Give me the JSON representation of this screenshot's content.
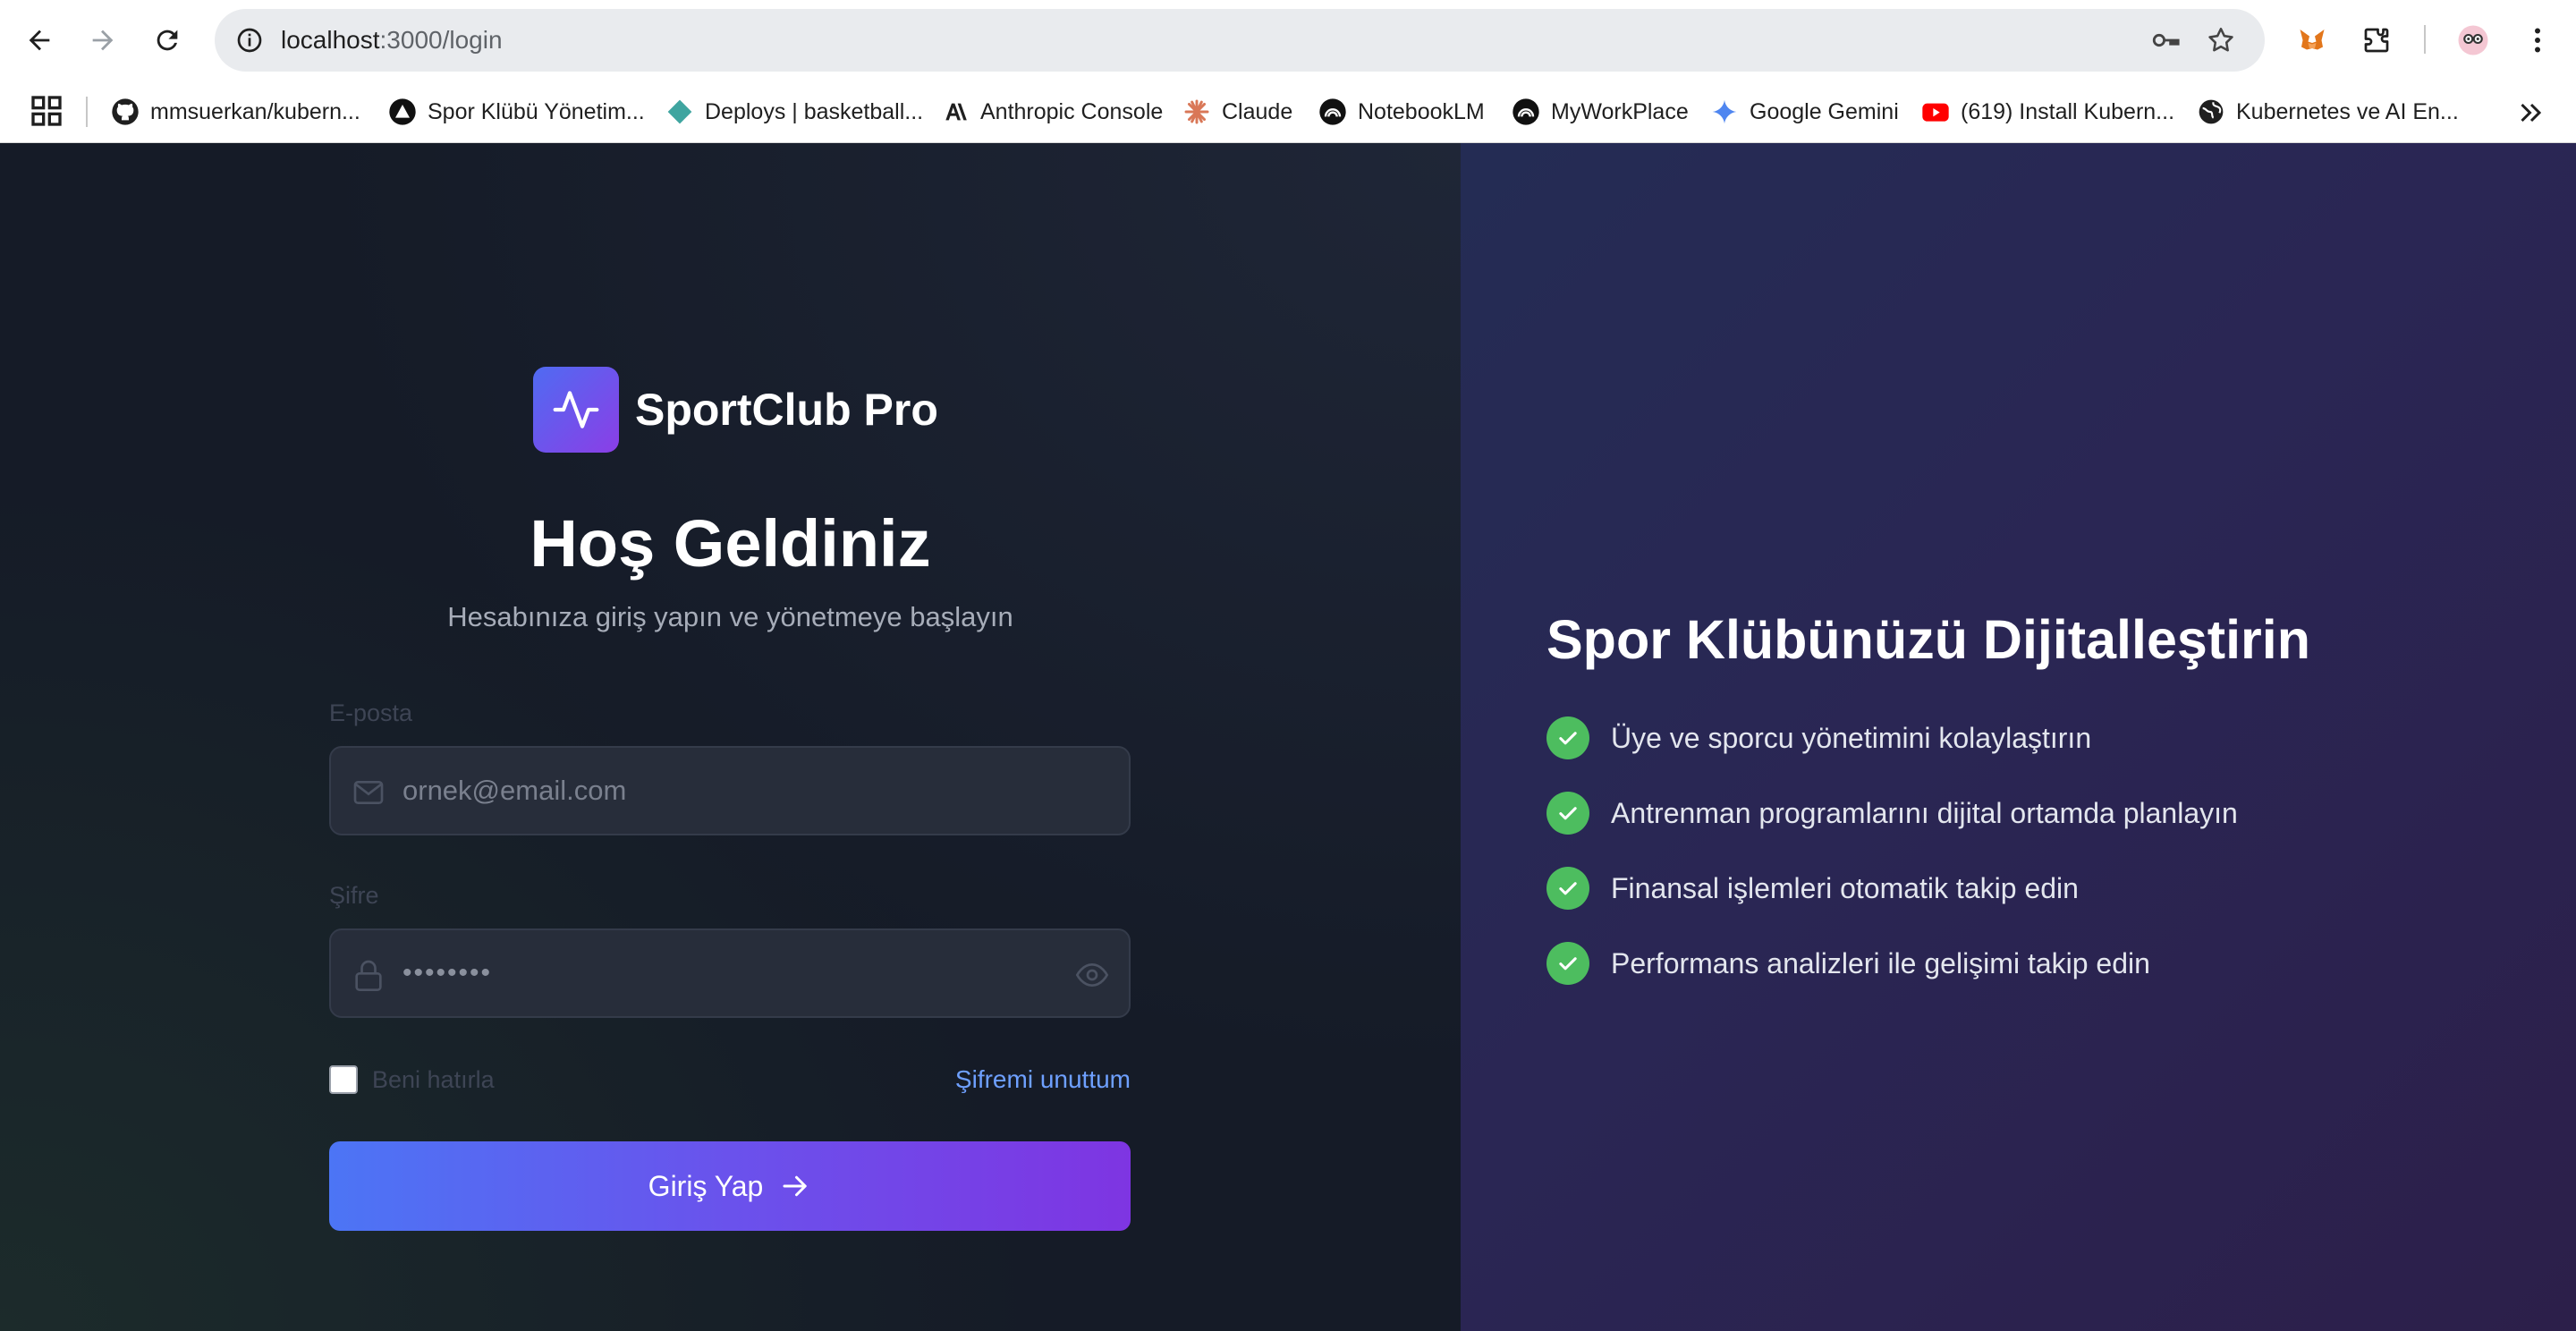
{
  "browser": {
    "url_host": "localhost",
    "url_path": ":3000/login",
    "bookmarks": [
      {
        "label": "mmsuerkan/kubern...",
        "icon": "github-icon"
      },
      {
        "label": "Spor Klübü Yönetim...",
        "icon": "triangle-icon"
      },
      {
        "label": "Deploys | basketball...",
        "icon": "diamond-icon"
      },
      {
        "label": "Anthropic Console",
        "icon": "anthropic-icon"
      },
      {
        "label": "Claude",
        "icon": "claude-icon"
      },
      {
        "label": "NotebookLM",
        "icon": "notebooklm-icon"
      },
      {
        "label": "MyWorkPlace",
        "icon": "notebooklm-icon"
      },
      {
        "label": "Google Gemini",
        "icon": "gemini-icon"
      },
      {
        "label": "(619) Install Kubern...",
        "icon": "youtube-icon"
      },
      {
        "label": "Kubernetes ve AI En...",
        "icon": "globe-icon"
      }
    ]
  },
  "brand": {
    "name": "SportClub Pro"
  },
  "login": {
    "title": "Hoş Geldiniz",
    "subtitle": "Hesabınıza giriş yapın ve yönetmeye başlayın",
    "email_label": "E-posta",
    "email_placeholder": "ornek@email.com",
    "password_label": "Şifre",
    "password_value": "••••••••",
    "remember_label": "Beni hatırla",
    "forgot_label": "Şifremi unuttum",
    "submit_label": "Giriş Yap"
  },
  "promo": {
    "title": "Spor Klübünüzü Dijitalleştirin",
    "features": [
      "Üye ve sporcu yönetimini kolaylaştırın",
      "Antrenman programlarını dijital ortamda planlayın",
      "Finansal işlemleri otomatik takip edin",
      "Performans analizleri ile gelişimi takip edin"
    ]
  },
  "colors": {
    "accent_start": "#4c75f5",
    "accent_end": "#7e35e2",
    "check_green": "#4dbd5f",
    "link_blue": "#6ea0ff"
  }
}
